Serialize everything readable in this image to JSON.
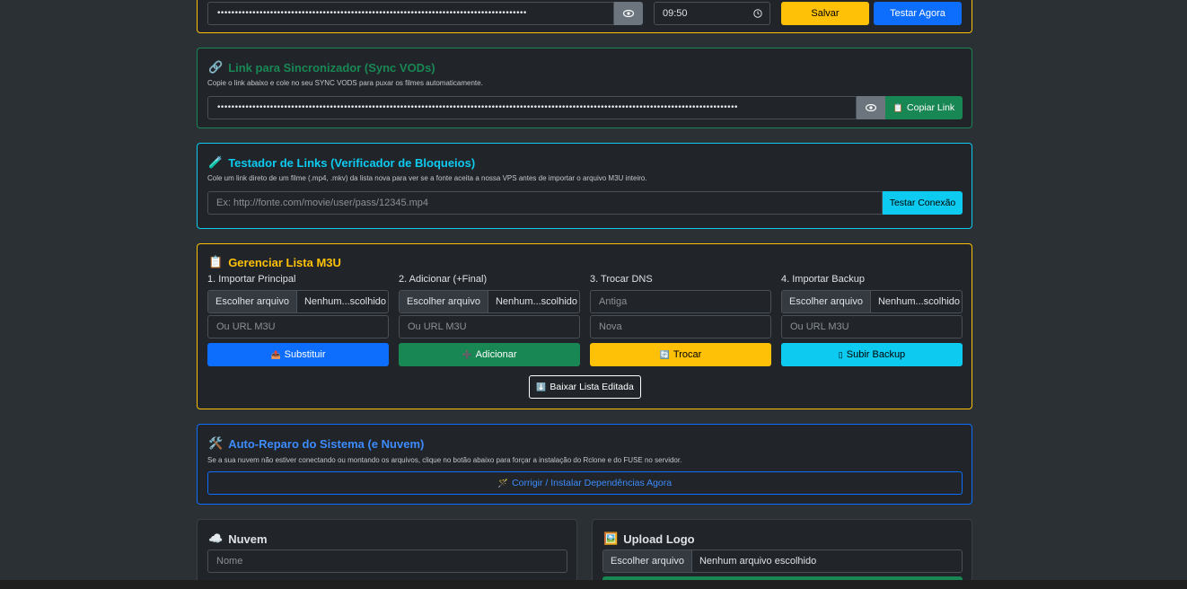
{
  "top": {
    "time_value": "09:50",
    "save_label": "Salvar",
    "test_label": "Testar Agora"
  },
  "sync": {
    "icon": "🔗",
    "title": "Link para Sincronizador (Sync VODs)",
    "desc": "Copie o link abaixo e cole no seu SYNC VODS para puxar os filmes automaticamente.",
    "copy_icon": "📋",
    "copy_label": "Copiar Link",
    "color": "#198754"
  },
  "tester": {
    "icon": "🧪",
    "title": "Testador de Links (Verificador de Bloqueios)",
    "desc": "Cole um link direto de um filme (.mp4, .mkv) da lista nova para ver se a fonte aceita a nossa VPS antes de importar o arquivo M3U inteiro.",
    "placeholder": "Ex: http://fonte.com/movie/user/pass/12345.mp4",
    "button_label": "Testar Conexão",
    "color": "#0dcaf0"
  },
  "m3u": {
    "icon": "📋",
    "title": "Gerenciar Lista M3U",
    "color": "#ffc107",
    "col1": {
      "label": "1. Importar Principal",
      "file_btn": "Escolher arquivo",
      "file_name": "Nenhum...scolhido",
      "url_placeholder": "Ou URL M3U",
      "btn_icon": "📤",
      "btn_label": "Substituir"
    },
    "col2": {
      "label": "2. Adicionar (+Final)",
      "file_btn": "Escolher arquivo",
      "file_name": "Nenhum...scolhido",
      "url_placeholder": "Ou URL M3U",
      "btn_icon": "➕",
      "btn_label": "Adicionar"
    },
    "col3": {
      "label": "3. Trocar DNS",
      "old_placeholder": "Antiga",
      "new_placeholder": "Nova",
      "btn_icon": "🔄",
      "btn_label": "Trocar"
    },
    "col4": {
      "label": "4. Importar Backup",
      "file_btn": "Escolher arquivo",
      "file_name": "Nenhum...scolhido",
      "url_placeholder": "Ou URL M3U",
      "btn_icon": "▯",
      "btn_label": "Subir Backup"
    },
    "download_icon": "⬇️",
    "download_label": "Baixar Lista Editada"
  },
  "repair": {
    "icon": "🛠️",
    "title": "Auto-Reparo do Sistema (e Nuvem)",
    "desc": "Se a sua nuvem não estiver conectando ou montando os arquivos, clique no botão abaixo para forçar a instalação do Rclone e do FUSE no servidor.",
    "button_icon": "🪄",
    "button_label": "Corrigir / Instalar Dependências Agora",
    "color": "#0d6efd"
  },
  "cloud": {
    "icon": "☁️",
    "title": "Nuvem",
    "name_placeholder": "Nome"
  },
  "logo": {
    "icon": "🖼️",
    "title": "Upload Logo",
    "file_btn": "Escolher arquivo",
    "file_name": "Nenhum arquivo escolhido"
  }
}
